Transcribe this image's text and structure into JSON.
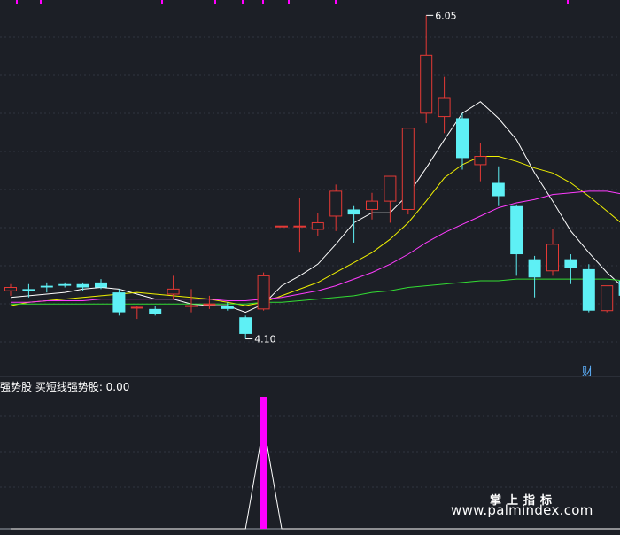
{
  "panel": {
    "indicator_title": "强势股  买短线强势股: 0.00",
    "finance_tag": "财",
    "watermark_cn": "掌上指标",
    "watermark_url": "www.palmindex.com"
  },
  "colors": {
    "background": "#1c1f26",
    "grid": "#2f3440",
    "up": "#e53935",
    "down": "#5ef0f5",
    "ma5": "#ffffff",
    "ma10": "#f0f000",
    "ma20": "#ff3cff",
    "ma60": "#33dd33",
    "signal": "#ff00ff"
  },
  "chart_data": [
    {
      "type": "candlestick",
      "y_range": [
        3.9,
        6.1
      ],
      "annotations": [
        {
          "label": "6.05",
          "value": 6.05,
          "at_candle": 23
        },
        {
          "label": "4.10",
          "value": 4.1,
          "at_candle": 13
        }
      ],
      "candles": [
        {
          "o": 4.39,
          "h": 4.43,
          "l": 4.36,
          "c": 4.41
        },
        {
          "o": 4.4,
          "h": 4.43,
          "l": 4.35,
          "c": 4.39
        },
        {
          "o": 4.42,
          "h": 4.44,
          "l": 4.38,
          "c": 4.41
        },
        {
          "o": 4.43,
          "h": 4.44,
          "l": 4.41,
          "c": 4.42
        },
        {
          "o": 4.43,
          "h": 4.44,
          "l": 4.39,
          "c": 4.41
        },
        {
          "o": 4.44,
          "h": 4.46,
          "l": 4.4,
          "c": 4.41
        },
        {
          "o": 4.38,
          "h": 4.4,
          "l": 4.24,
          "c": 4.26
        },
        {
          "o": 4.29,
          "h": 4.3,
          "l": 4.22,
          "c": 4.29
        },
        {
          "o": 4.28,
          "h": 4.3,
          "l": 4.24,
          "c": 4.25
        },
        {
          "o": 4.37,
          "h": 4.48,
          "l": 4.34,
          "c": 4.4
        },
        {
          "o": 4.3,
          "h": 4.4,
          "l": 4.26,
          "c": 4.3
        },
        {
          "o": 4.31,
          "h": 4.36,
          "l": 4.28,
          "c": 4.31
        },
        {
          "o": 4.3,
          "h": 4.32,
          "l": 4.27,
          "c": 4.28
        },
        {
          "o": 4.23,
          "h": 4.24,
          "l": 4.1,
          "c": 4.13
        },
        {
          "o": 4.28,
          "h": 4.5,
          "l": 4.27,
          "c": 4.48
        },
        {
          "o": 4.78,
          "h": 4.78,
          "l": 4.78,
          "c": 4.78
        },
        {
          "o": 4.78,
          "h": 4.95,
          "l": 4.62,
          "c": 4.78
        },
        {
          "o": 4.76,
          "h": 4.86,
          "l": 4.72,
          "c": 4.8
        },
        {
          "o": 4.84,
          "h": 5.03,
          "l": 4.75,
          "c": 4.99
        },
        {
          "o": 4.88,
          "h": 4.9,
          "l": 4.68,
          "c": 4.85
        },
        {
          "o": 4.88,
          "h": 4.98,
          "l": 4.82,
          "c": 4.93
        },
        {
          "o": 4.93,
          "h": 5.07,
          "l": 4.8,
          "c": 5.08
        },
        {
          "o": 4.88,
          "h": 5.36,
          "l": 4.85,
          "c": 5.37
        },
        {
          "o": 5.46,
          "h": 6.05,
          "l": 5.4,
          "c": 5.81
        },
        {
          "o": 5.44,
          "h": 5.68,
          "l": 5.34,
          "c": 5.55
        },
        {
          "o": 5.43,
          "h": 5.46,
          "l": 5.12,
          "c": 5.19
        },
        {
          "o": 5.15,
          "h": 5.28,
          "l": 5.05,
          "c": 5.2
        },
        {
          "o": 5.04,
          "h": 5.14,
          "l": 4.9,
          "c": 4.96
        },
        {
          "o": 4.9,
          "h": 4.91,
          "l": 4.48,
          "c": 4.61
        },
        {
          "o": 4.58,
          "h": 4.6,
          "l": 4.35,
          "c": 4.47
        },
        {
          "o": 4.51,
          "h": 4.76,
          "l": 4.48,
          "c": 4.67
        },
        {
          "o": 4.58,
          "h": 4.61,
          "l": 4.43,
          "c": 4.53
        },
        {
          "o": 4.52,
          "h": 4.55,
          "l": 4.26,
          "c": 4.27
        },
        {
          "o": 4.27,
          "h": 4.42,
          "l": 4.26,
          "c": 4.42
        },
        {
          "o": 4.45,
          "h": 4.46,
          "l": 4.32,
          "c": 4.36
        }
      ],
      "ma_series": [
        {
          "name": "MA5",
          "values": [
            4.35,
            4.36,
            4.37,
            4.38,
            4.4,
            4.41,
            4.4,
            4.37,
            4.34,
            4.34,
            4.31,
            4.3,
            4.3,
            4.26,
            4.31,
            4.42,
            4.48,
            4.55,
            4.67,
            4.8,
            4.86,
            4.86,
            4.97,
            5.13,
            5.3,
            5.46,
            5.53,
            5.43,
            5.3,
            5.1,
            4.93,
            4.75,
            4.62,
            4.5,
            4.4
          ]
        },
        {
          "name": "MA10",
          "values": [
            4.3,
            4.32,
            4.33,
            4.34,
            4.35,
            4.36,
            4.37,
            4.38,
            4.37,
            4.36,
            4.35,
            4.34,
            4.32,
            4.3,
            4.32,
            4.36,
            4.4,
            4.44,
            4.5,
            4.56,
            4.62,
            4.7,
            4.8,
            4.93,
            5.07,
            5.15,
            5.2,
            5.2,
            5.17,
            5.13,
            5.1,
            5.04,
            4.96,
            4.87,
            4.78
          ]
        },
        {
          "name": "MA20",
          "values": [
            4.32,
            4.32,
            4.33,
            4.33,
            4.33,
            4.34,
            4.34,
            4.34,
            4.34,
            4.34,
            4.34,
            4.34,
            4.33,
            4.33,
            4.34,
            4.35,
            4.37,
            4.39,
            4.42,
            4.46,
            4.5,
            4.55,
            4.61,
            4.68,
            4.74,
            4.79,
            4.84,
            4.89,
            4.92,
            4.94,
            4.97,
            4.98,
            4.99,
            4.99,
            4.97
          ]
        },
        {
          "name": "MA60",
          "values": [
            4.31,
            4.31,
            4.31,
            4.31,
            4.31,
            4.31,
            4.31,
            4.31,
            4.31,
            4.31,
            4.31,
            4.31,
            4.31,
            4.31,
            4.32,
            4.32,
            4.33,
            4.34,
            4.35,
            4.36,
            4.38,
            4.39,
            4.41,
            4.42,
            4.43,
            4.44,
            4.45,
            4.45,
            4.46,
            4.46,
            4.46,
            4.46,
            4.46,
            4.46,
            4.45
          ]
        }
      ]
    },
    {
      "type": "bar",
      "series": [
        {
          "values": [
            0,
            0,
            0,
            0,
            0,
            0,
            0,
            0,
            0,
            0,
            0,
            0,
            0,
            0,
            1,
            0,
            0,
            0,
            0,
            0,
            0,
            0,
            0,
            0,
            0,
            0,
            0,
            0,
            0,
            0,
            0,
            0,
            0,
            0,
            0
          ]
        }
      ],
      "ylim": [
        0,
        1
      ]
    }
  ]
}
